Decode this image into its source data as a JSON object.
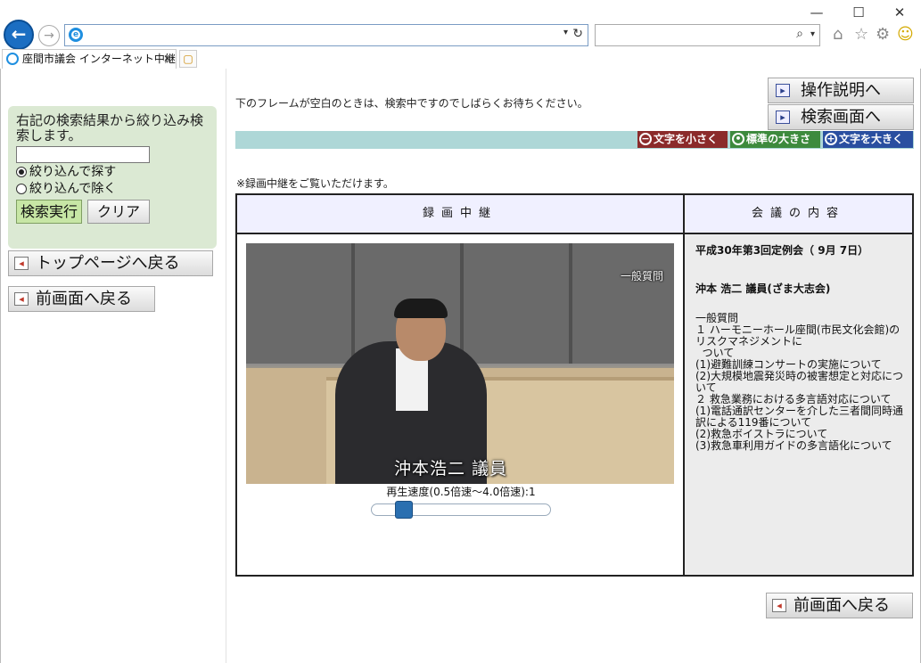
{
  "browser": {
    "tab_title": "座間市議会 インターネット中継",
    "address_value": "",
    "search_value": ""
  },
  "left": {
    "search_intro": "右記の検索結果から絞り込み検索します。",
    "search_input": "",
    "radio_include": "絞り込んで探す",
    "radio_exclude": "絞り込んで除く",
    "radio_selected": "include",
    "exec_label": "検索実行",
    "clear_label": "クリア",
    "top_page_label": "トップページへ戻る",
    "prev_label": "前画面へ戻る"
  },
  "right": {
    "notice": "下のフレームが空白のときは、検索中ですのでしばらくお待ちください。",
    "manual_label": "操作説明へ",
    "search_screen_label": "検索画面へ",
    "font_small": "文字を小さく",
    "font_normal": "標準の大きさ",
    "font_large": "文字を大きく",
    "recording_note": "※録画中継をご覧いただけます。",
    "col_video": "録画中継",
    "col_content": "会議の内容",
    "video_badge": "一般質問",
    "video_caption": "沖本浩二 議員",
    "speed_label": "再生速度(0.5倍速〜4.0倍速):1",
    "speed_value": 1,
    "speed_min": 0.5,
    "speed_max": 4.0,
    "session": "平成30年第3回定例会（ 9月 7日）",
    "member": "沖本 浩二 議員(ざま大志会)",
    "content": "一般質問\n１ ハーモニーホール座間(市民文化会館)のリスクマネジメントに\n  ついて\n(1)避難訓練コンサートの実施について\n(2)大規模地震発災時の被害想定と対応について\n２ 救急業務における多言語対応について\n(1)電話通訳センターを介した三者間同時通訳による119番について\n(2)救急ボイストラについて\n(3)救急車利用ガイドの多言語化について",
    "back_label": "前画面へ戻る"
  },
  "colors": {
    "left_panel": "#dbe9d3",
    "font_bar": "#aed7d7",
    "font_small_bg": "#8b2b2b",
    "font_normal_bg": "#3d8a3d",
    "font_large_bg": "#2a4fa0",
    "table_header": "#f0f0ff",
    "info_bg": "#ececec"
  }
}
